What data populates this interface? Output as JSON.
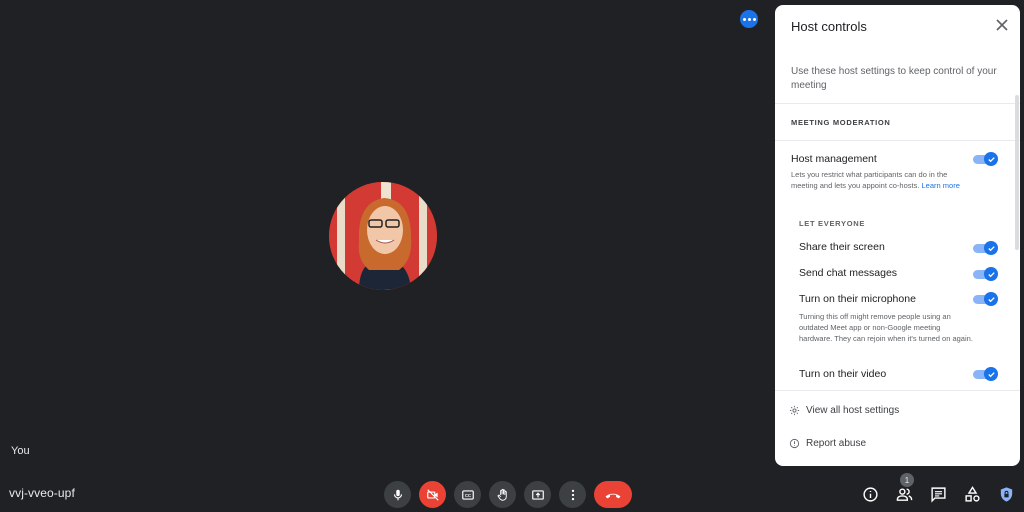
{
  "stage": {
    "self_label": "You",
    "meeting_code": "vvj-vveo-upf"
  },
  "controls": [
    {
      "name": "microphone-button",
      "icon": "microphone-icon",
      "state": "on"
    },
    {
      "name": "camera-button",
      "icon": "camera-off-icon",
      "state": "off"
    },
    {
      "name": "captions-button",
      "icon": "captions-icon"
    },
    {
      "name": "raise-hand-button",
      "icon": "hand-icon"
    },
    {
      "name": "present-button",
      "icon": "present-screen-icon"
    },
    {
      "name": "more-options-button",
      "icon": "more-vert-icon"
    },
    {
      "name": "leave-call-button",
      "icon": "hang-up-icon"
    }
  ],
  "right_icons": {
    "participants_count": "1"
  },
  "panel": {
    "title": "Host controls",
    "intro": "Use these host settings to keep control of your meeting",
    "section_title": "MEETING MODERATION",
    "host_management": {
      "title": "Host management",
      "desc": "Lets you restrict what participants can do in the meeting and lets you appoint co-hosts.",
      "link": "Learn more",
      "enabled": true
    },
    "let_everyone_title": "LET EVERYONE",
    "settings": [
      {
        "title": "Share their screen",
        "enabled": true
      },
      {
        "title": "Send chat messages",
        "enabled": true
      },
      {
        "title": "Turn on their microphone",
        "desc": "Turning this off might remove people using an outdated Meet app or non-Google meeting hardware. They can rejoin when it's turned on again.",
        "enabled": true
      },
      {
        "title": "Turn on their video",
        "enabled": true
      }
    ],
    "footer": {
      "view_all": "View all host settings",
      "report": "Report abuse"
    }
  },
  "colors": {
    "background": "#202124",
    "accent": "#1a73e8",
    "danger": "#ea4335"
  }
}
